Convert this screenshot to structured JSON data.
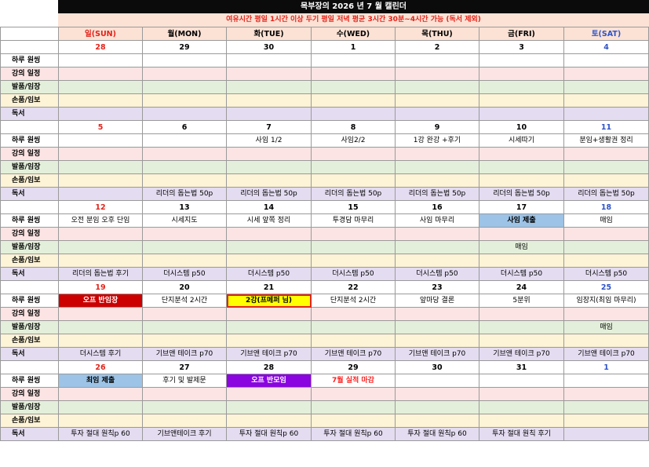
{
  "title": "목부장의 2026 년 7 월 캘린더",
  "subtitle": "여유시간 평일 1시간 이상 두기 평일 저녁 평균 3시간 30분~4시간 가능 (독서 제외)",
  "days": [
    "일(SUN)",
    "월(MON)",
    "화(TUE)",
    "수(WED)",
    "목(THU)",
    "금(FRI)",
    "토(SAT)"
  ],
  "labels": [
    "하루 원씽",
    "강의 일정",
    "발품/임장",
    "손품/임보",
    "독서"
  ],
  "weeks": [
    {
      "dates": [
        "28",
        "29",
        "30",
        "1",
        "2",
        "3",
        "4"
      ],
      "rows": [
        [
          "",
          "",
          "",
          "",
          "",
          "",
          ""
        ],
        [
          "",
          "",
          "",
          "",
          "",
          "",
          ""
        ],
        [
          "",
          "",
          "",
          "",
          "",
          "",
          ""
        ],
        [
          "",
          "",
          "",
          "",
          "",
          "",
          ""
        ],
        [
          "",
          "",
          "",
          "",
          "",
          "",
          ""
        ]
      ]
    },
    {
      "dates": [
        "5",
        "6",
        "7",
        "8",
        "9",
        "10",
        "11"
      ],
      "rows": [
        [
          "",
          "",
          "사임 1/2",
          "사임2/2",
          "1강 완강 +후기",
          "시세따기",
          "분임+생활권 정리"
        ],
        [
          "",
          "",
          "",
          "",
          "",
          "",
          ""
        ],
        [
          "",
          "",
          "",
          "",
          "",
          "",
          ""
        ],
        [
          "",
          "",
          "",
          "",
          "",
          "",
          ""
        ],
        [
          "",
          "리더의 돕는법 50p",
          "리더의 돕는법 50p",
          "리더의 돕는법 50p",
          "리더의 돕는법 50p",
          "리더의 돕는법 50p",
          "리더의 돕는법 50p"
        ]
      ]
    },
    {
      "dates": [
        "12",
        "13",
        "14",
        "15",
        "16",
        "17",
        "18"
      ],
      "rows": [
        [
          "오전 분임 오후 단임",
          "시세지도",
          "시세 앞쪽 정리",
          "투경담 마무리",
          "사임 마무리",
          "사임 제출",
          "매임"
        ],
        [
          "",
          "",
          "",
          "",
          "",
          "",
          ""
        ],
        [
          "",
          "",
          "",
          "",
          "",
          "매임",
          ""
        ],
        [
          "",
          "",
          "",
          "",
          "",
          "",
          ""
        ],
        [
          "리더의 돕는법 후기",
          "더시스템 p50",
          "더시스템 p50",
          "더시스템 p50",
          "더시스템 p50",
          "더시스템 p50",
          "더시스템 p50"
        ]
      ]
    },
    {
      "dates": [
        "19",
        "20",
        "21",
        "22",
        "23",
        "24",
        "25"
      ],
      "rows": [
        [
          "오프 반임장",
          "단지분석 2시간",
          "2강(프메퍼 님)",
          "단지분석 2시간",
          "앞마당 결론",
          "5분위",
          "임장지(최임 마무리)"
        ],
        [
          "",
          "",
          "",
          "",
          "",
          "",
          ""
        ],
        [
          "",
          "",
          "",
          "",
          "",
          "",
          "매임"
        ],
        [
          "",
          "",
          "",
          "",
          "",
          "",
          ""
        ],
        [
          "더시스템 후기",
          "기브앤 테이크 p70",
          "기브앤 테이크 p70",
          "기브앤 테이크 p70",
          "기브앤 테이크 p70",
          "기브앤 테이크 p70",
          "기브앤 테이크 p70"
        ]
      ]
    },
    {
      "dates": [
        "26",
        "27",
        "28",
        "29",
        "30",
        "31",
        "1"
      ],
      "rows": [
        [
          "최임 제출",
          "후기 및 발제문",
          "오프 반모임",
          "7월 실적 마감",
          "",
          "",
          ""
        ],
        [
          "",
          "",
          "",
          "",
          "",
          "",
          ""
        ],
        [
          "",
          "",
          "",
          "",
          "",
          "",
          ""
        ],
        [
          "",
          "",
          "",
          "",
          "",
          "",
          ""
        ],
        [
          "투자 절대 원칙p 60",
          "기브앤테이크 후기",
          "투자 절대 원칙p 60",
          "투자 절대 원칙p 60",
          "투자 절대 원칙p 60",
          "투자 절대 원칙 후기",
          ""
        ]
      ]
    }
  ],
  "colors": {
    "sunday": "#e2231a",
    "saturday": "#2f53c9",
    "title_bg": "#0b0b0b",
    "header_bg": "#fbe2d5",
    "row_one_thing": "#ffffff",
    "row_lecture": "#fde4e4",
    "row_imjang": "#e3efda",
    "row_imbo": "#fdf3d6",
    "row_reading": "#e4dcf1",
    "event_blue": "#9dc3e6",
    "event_red": "#cc0000",
    "event_yellow": "#ffff00",
    "event_purple": "#8a05e0"
  }
}
